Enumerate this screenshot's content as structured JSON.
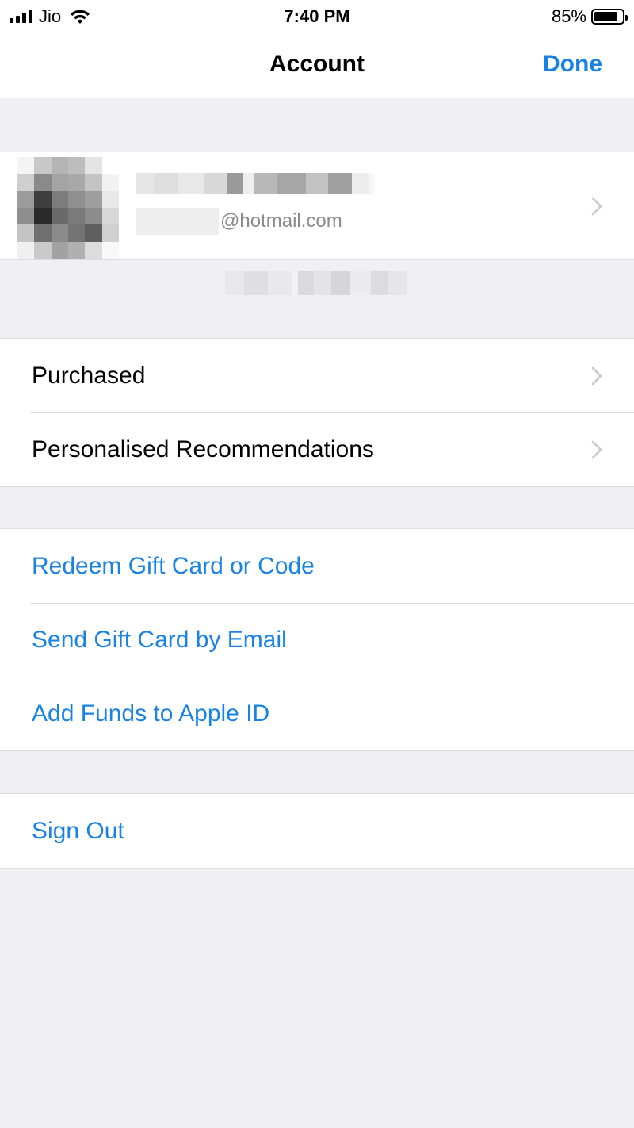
{
  "status_bar": {
    "carrier": "Jio",
    "time": "7:40 PM",
    "battery_percent_label": "85%",
    "battery_level": 0.85
  },
  "nav": {
    "title": "Account",
    "done_label": "Done"
  },
  "profile": {
    "email_suffix": "@hotmail.com"
  },
  "menu_group_1": [
    {
      "label": "Purchased"
    },
    {
      "label": "Personalised Recommendations"
    }
  ],
  "menu_group_2": [
    {
      "label": "Redeem Gift Card or Code"
    },
    {
      "label": "Send Gift Card by Email"
    },
    {
      "label": "Add Funds to Apple ID"
    }
  ],
  "menu_group_3": [
    {
      "label": "Sign Out"
    }
  ],
  "colors": {
    "accent": "#1a82e2",
    "background": "#efeff4",
    "separator": "#dcdce0",
    "chevron": "#c7c7cc"
  }
}
